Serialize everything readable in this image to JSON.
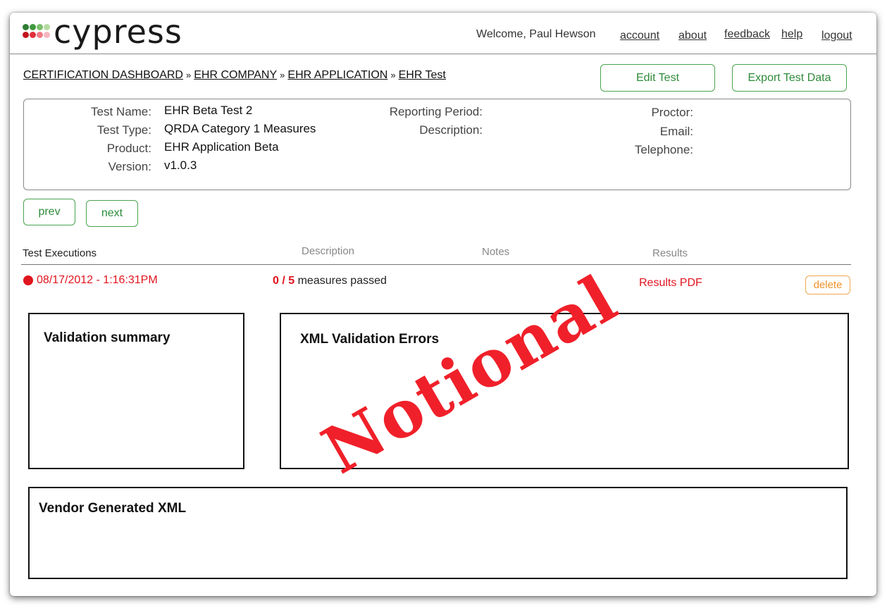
{
  "app": {
    "logo_text": "cypress"
  },
  "topnav": {
    "welcome": "Welcome, Paul Hewson",
    "account": "account",
    "about": "about",
    "feedback": "feedback",
    "help": "help",
    "logout": "logout"
  },
  "breadcrumb": {
    "items": [
      "CERTIFICATION DASHBOARD",
      "EHR COMPANY",
      "EHR APPLICATION",
      "EHR Test"
    ],
    "separator": "»"
  },
  "actions": {
    "edit_test": "Edit Test",
    "export_test_data": "Export Test Data"
  },
  "test_info": {
    "name_label": "Test Name:",
    "name_value": "EHR Beta Test 2",
    "type_label": "Test Type:",
    "type_value": "QRDA Category 1 Measures",
    "product_label": "Product:",
    "product_value": "EHR Application Beta",
    "version_label": "Version:",
    "version_value": "v1.0.3",
    "reporting_period_label": "Reporting Period:",
    "description_label": "Description:",
    "proctor_label": "Proctor:",
    "email_label": "Email:",
    "telephone_label": "Telephone:"
  },
  "pager": {
    "prev": "prev",
    "next": "next"
  },
  "executions": {
    "headers": {
      "test_executions": "Test Executions",
      "description": "Description",
      "notes": "Notes",
      "results": "Results"
    },
    "rows": [
      {
        "timestamp": "08/17/2012 - 1:16:31PM",
        "passed": "0 / 5",
        "passed_suffix": "measures passed",
        "results_link": "Results PDF",
        "delete": "delete",
        "status_color": "#e0141e"
      }
    ]
  },
  "panels": {
    "validation_summary": "Validation summary",
    "xml_validation_errors": "XML Validation Errors",
    "vendor_generated_xml": "Vendor Generated XML"
  },
  "watermark": "Notional",
  "colors": {
    "accent_green": "#4aa34e",
    "error_red": "#e0141e",
    "delete_orange": "#f0932b"
  }
}
